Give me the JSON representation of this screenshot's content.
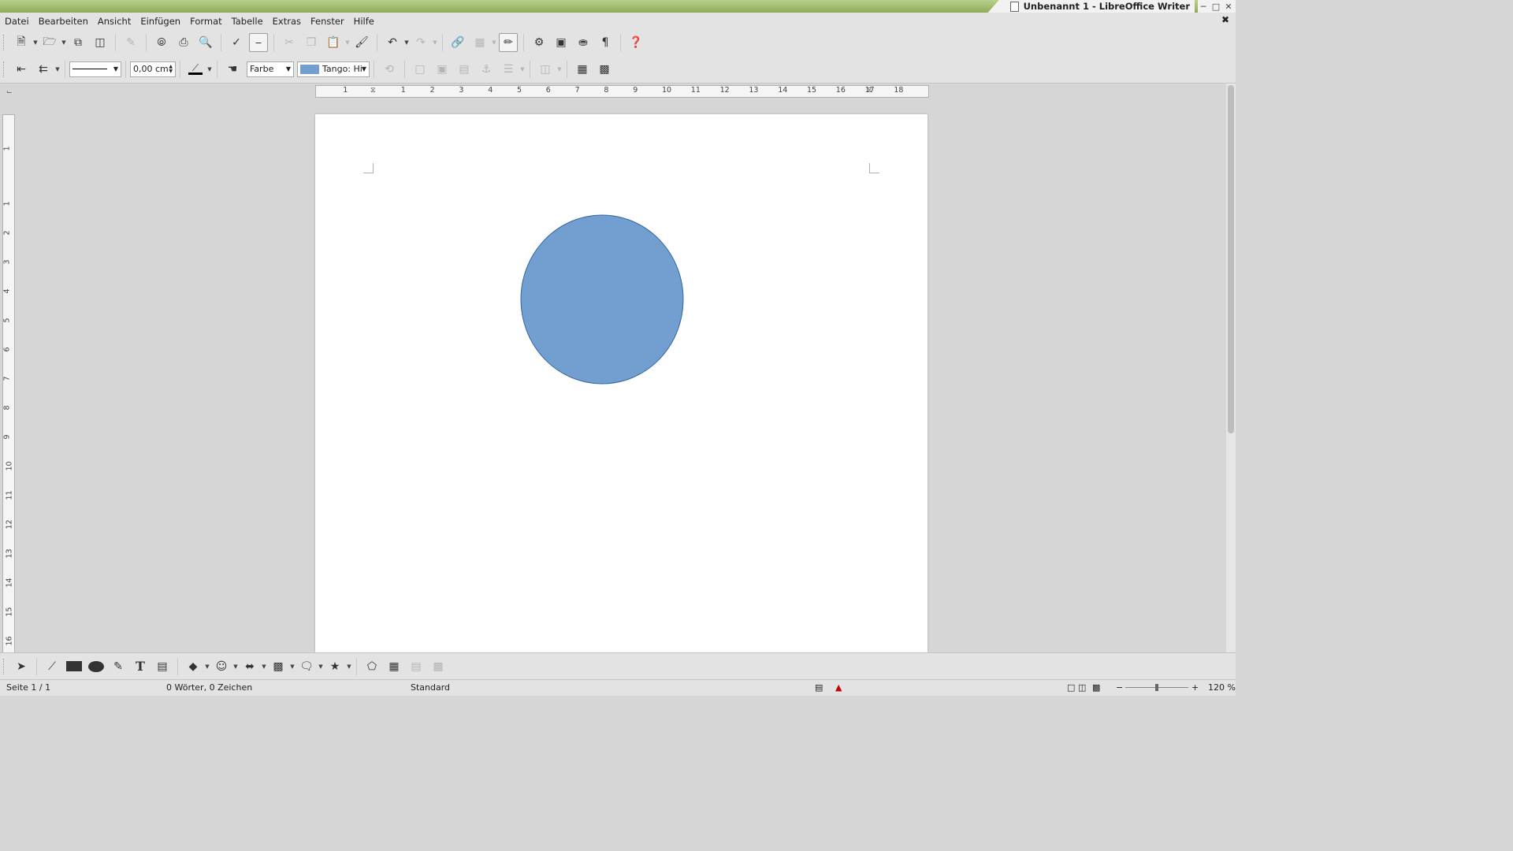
{
  "window": {
    "title": "Unbenannt 1 - LibreOffice Writer",
    "buttons": [
      "minimize-icon",
      "maximize-icon",
      "close-icon"
    ]
  },
  "menu": {
    "items": [
      "Datei",
      "Bearbeiten",
      "Ansicht",
      "Einfügen",
      "Format",
      "Tabelle",
      "Extras",
      "Fenster",
      "Hilfe"
    ]
  },
  "format_toolbar": {
    "line_width": "0,00 cm",
    "area_style": "Farbe",
    "area_fill": "Tango: Hi",
    "area_fill_color": "#729fcf"
  },
  "rulers": {
    "horizontal_ticks": [
      "1",
      "1",
      "2",
      "3",
      "4",
      "5",
      "6",
      "7",
      "8",
      "9",
      "10",
      "11",
      "12",
      "13",
      "14",
      "15",
      "16",
      "17",
      "18"
    ],
    "vertical_ticks": [
      "1",
      "1",
      "2",
      "3",
      "4",
      "5",
      "6",
      "7",
      "8",
      "9",
      "10",
      "11",
      "12",
      "13",
      "14",
      "15",
      "16"
    ]
  },
  "shape": {
    "type": "ellipse",
    "fill": "#729fcf",
    "stroke": "#3465a4"
  },
  "status": {
    "page": "Seite 1 / 1",
    "words": "0 Wörter, 0 Zeichen",
    "page_style": "Standard",
    "zoom": "120 %"
  }
}
